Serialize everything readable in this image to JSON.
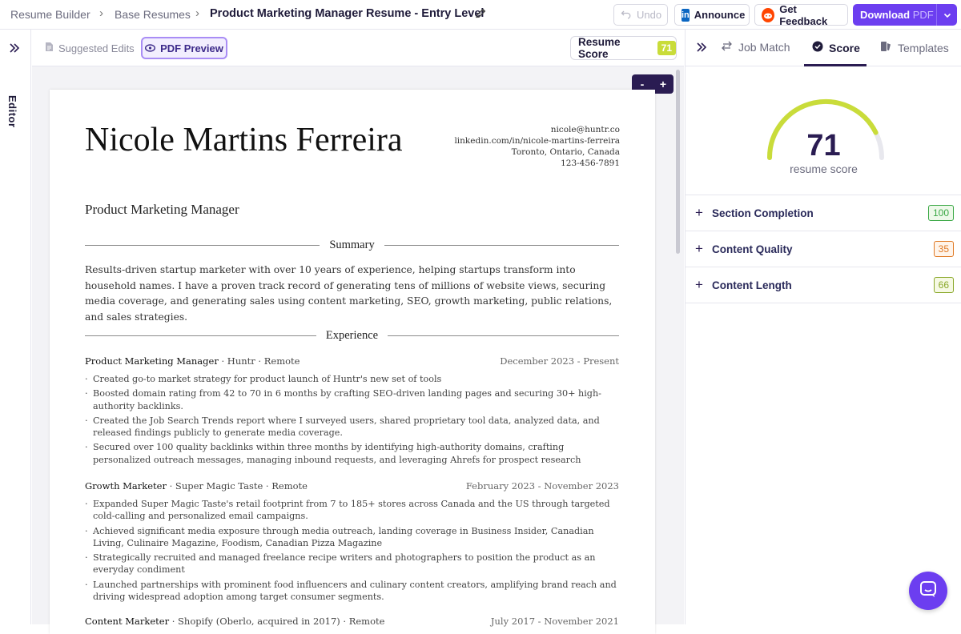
{
  "breadcrumb": {
    "items": [
      "Resume Builder",
      "Base Resumes"
    ],
    "current": "Product Marketing Manager Resume - Entry Level"
  },
  "topbar": {
    "undo_label": "Undo",
    "announce_label": "Announce",
    "feedback_label": "Get Feedback",
    "download_label": "Download",
    "download_format": "PDF"
  },
  "left_rail": {
    "label": "Editor"
  },
  "toolbar": {
    "suggested_edits": "Suggested Edits",
    "pdf_preview": "PDF Preview",
    "resume_score_label": "Resume Score",
    "resume_score_value": "71"
  },
  "zoom": {
    "minus": "-",
    "plus": "+"
  },
  "resume": {
    "name": "Nicole Martins Ferreira",
    "role": "Product Marketing Manager",
    "contact": {
      "email": "nicole@huntr.co",
      "linkedin": "linkedin.com/in/nicole-martins-ferreira",
      "location": "Toronto, Ontario, Canada",
      "phone": "123-456-7891"
    },
    "summary_heading": "Summary",
    "summary": "Results-driven startup marketer with over 10 years of experience, helping startups transform into household names. I have a proven track record of generating tens of millions of website views, securing media coverage, and generating sales using content marketing, SEO, growth marketing, public relations, and sales strategies.",
    "experience_heading": "Experience",
    "jobs": [
      {
        "title": "Product Marketing Manager",
        "meta": " · Huntr · Remote",
        "dates": "December 2023 - Present",
        "bullets": [
          "Created go-to market strategy for product launch of Huntr's new set of tools",
          "Boosted domain rating from 42 to 70 in 6 months by crafting SEO-driven landing pages and securing 30+ high-authority backlinks.",
          "Created the Job Search Trends report where I surveyed users, shared proprietary tool data, analyzed data, and released findings publicly to generate media coverage.",
          "Secured over 100 quality backlinks within three months by identifying high-authority domains, crafting personalized outreach messages, managing inbound requests, and leveraging Ahrefs for prospect research"
        ]
      },
      {
        "title": "Growth Marketer",
        "meta": " · Super Magic Taste · Remote",
        "dates": "February 2023 - November 2023",
        "bullets": [
          "Expanded Super Magic Taste's retail footprint from 7 to 185+ stores across Canada and the US through targeted cold-calling and personalized email campaigns.",
          "Achieved significant media exposure through media outreach, landing coverage in Business Insider, Canadian Living, Culinaire Magazine, Foodism, Canadian Pizza Magazine",
          "Strategically recruited and managed freelance recipe writers and photographers to position the product as an everyday condiment",
          "Launched partnerships with prominent food influencers and culinary content creators, amplifying brand reach and driving widespread adoption among target consumer segments."
        ]
      },
      {
        "title": "Content Marketer",
        "meta": " · Shopify (Oberlo, acquired in 2017) · Remote",
        "dates": "July 2017 - November 2021",
        "bullets": []
      }
    ]
  },
  "right_panel": {
    "tabs": [
      "Job Match",
      "Score",
      "Templates"
    ],
    "active_tab": "Score",
    "score": 71,
    "score_caption": "resume score",
    "rows": [
      {
        "label": "Section Completion",
        "value": "100",
        "color": "#3aa845",
        "bg": "#eef9ea"
      },
      {
        "label": "Content Quality",
        "value": "35",
        "color": "#e07a25",
        "bg": "#fff4ea"
      },
      {
        "label": "Content Length",
        "value": "66",
        "color": "#8aa82a",
        "bg": "#f6f9e4"
      }
    ]
  },
  "colors": {
    "brand": "#6c3ef0",
    "dark": "#2a1c52",
    "gauge_fill": "#c9dc3a",
    "gauge_track": "#e8e8ee"
  }
}
